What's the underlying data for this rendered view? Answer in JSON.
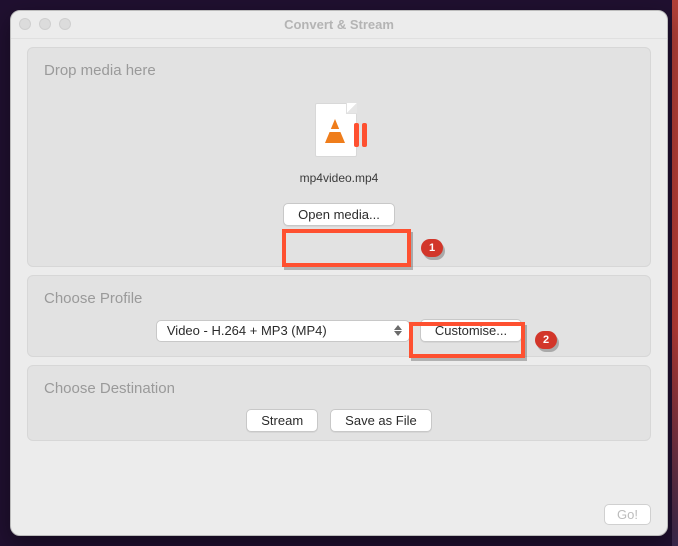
{
  "window": {
    "title": "Convert & Stream"
  },
  "drop": {
    "heading": "Drop media here",
    "filename": "mp4video.mp4",
    "open_media_label": "Open media..."
  },
  "profile": {
    "heading": "Choose Profile",
    "selected": "Video - H.264 + MP3 (MP4)",
    "customise_label": "Customise..."
  },
  "destination": {
    "heading": "Choose Destination",
    "stream_label": "Stream",
    "save_label": "Save as File"
  },
  "footer": {
    "go_label": "Go!"
  },
  "annotations": {
    "badge1": "1",
    "badge2": "2"
  }
}
